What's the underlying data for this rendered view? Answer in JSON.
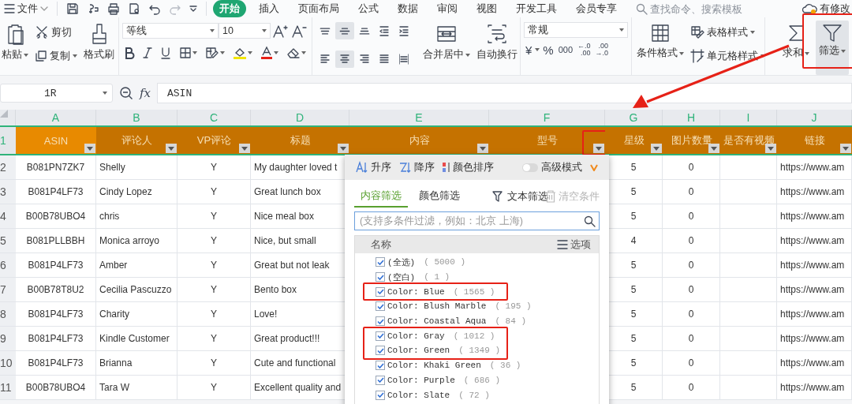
{
  "menu_bar": {
    "file_label": "文件",
    "tabs": [
      {
        "label": "开始",
        "selected": true
      },
      {
        "label": "插入",
        "selected": false
      },
      {
        "label": "页面布局",
        "selected": false
      },
      {
        "label": "公式",
        "selected": false
      },
      {
        "label": "数据",
        "selected": false
      },
      {
        "label": "审阅",
        "selected": false
      },
      {
        "label": "视图",
        "selected": false
      },
      {
        "label": "开发工具",
        "selected": false
      },
      {
        "label": "会员专享",
        "selected": false
      }
    ],
    "search": {
      "placeholder": "查找命令、搜索模板"
    },
    "status": "有修改"
  },
  "ribbon": {
    "clipboard": {
      "paste": "粘贴",
      "cut": "剪切",
      "copy": "复制",
      "format_painter": "格式刷"
    },
    "font": {
      "family": "等线",
      "size": "10"
    },
    "alignment": [
      {
        "kind": "top",
        "selected": false
      },
      {
        "kind": "middle",
        "selected": true
      },
      {
        "kind": "bottom",
        "selected": false
      },
      {
        "kind": "outdent",
        "selected": false
      },
      {
        "kind": "indent",
        "selected": false
      },
      {
        "kind": "left",
        "selected": false
      },
      {
        "kind": "center",
        "selected": true
      },
      {
        "kind": "right",
        "selected": false
      },
      {
        "kind": "justify",
        "selected": false
      },
      {
        "kind": "distribute",
        "selected": false
      }
    ],
    "merge": "合并居中",
    "wrap": "自动换行",
    "number": {
      "format": "常规",
      "currency": "¥",
      "percent": "%",
      "thousands": "000",
      "increase_decimal": [
        "←.0",
        ".00"
      ],
      "decrease_decimal": [
        ".00",
        "→.0"
      ]
    },
    "styles": {
      "conditional": "条件格式",
      "table_style": "表格样式",
      "cell_style": "单元格样式"
    },
    "sum": "求和",
    "filter": {
      "label": "筛选",
      "selected": true,
      "highlighted": true
    }
  },
  "formula_bar": {
    "name_box": "1R",
    "fx_label": "fx",
    "formula": "ASIN"
  },
  "sheet": {
    "columns": [
      "A",
      "B",
      "C",
      "D",
      "E",
      "F",
      "G",
      "H",
      "I",
      "J"
    ],
    "header_row": {
      "number": "1",
      "cells": [
        {
          "text": "ASIN",
          "selected": true,
          "highlighted": false
        },
        {
          "text": "评论人",
          "selected": false,
          "highlighted": false
        },
        {
          "text": "VP评论",
          "selected": false,
          "highlighted": false
        },
        {
          "text": "标题",
          "selected": false,
          "highlighted": false
        },
        {
          "text": "内容",
          "selected": false,
          "highlighted": false
        },
        {
          "text": "型号",
          "selected": false,
          "highlighted": true
        },
        {
          "text": "星级",
          "selected": false,
          "highlighted": false
        },
        {
          "text": "图片数量",
          "selected": false,
          "highlighted": false
        },
        {
          "text": "是否有视频",
          "selected": false,
          "highlighted": false
        },
        {
          "text": "链接",
          "selected": false,
          "highlighted": false
        }
      ]
    },
    "rows": [
      {
        "number": "2",
        "asin": "B081PN7ZK7",
        "reviewer": "Shelly",
        "vp": "Y",
        "title": "My daughter loved t",
        "rating": "5",
        "images": "0",
        "link": "https://www.am"
      },
      {
        "number": "3",
        "asin": "B081P4LF73",
        "reviewer": "Cindy Lopez",
        "vp": "Y",
        "title": "Great lunch box",
        "rating": "5",
        "images": "0",
        "link": "https://www.am"
      },
      {
        "number": "4",
        "asin": "B00B78UBO4",
        "reviewer": "chris",
        "vp": "Y",
        "title": "Nice meal box",
        "rating": "5",
        "images": "0",
        "link": "https://www.am"
      },
      {
        "number": "5",
        "asin": "B081PLLBBH",
        "reviewer": "Monica arroyo",
        "vp": "Y",
        "title": "Nice, but small",
        "rating": "4",
        "images": "0",
        "link": "https://www.am"
      },
      {
        "number": "6",
        "asin": "B081P4LF73",
        "reviewer": "Amber",
        "vp": "Y",
        "title": "Great but not leak",
        "rating": "5",
        "images": "0",
        "link": "https://www.am"
      },
      {
        "number": "7",
        "asin": "B00B78T8U2",
        "reviewer": "Cecilia Pascuzzo",
        "vp": "Y",
        "title": "Bento box",
        "rating": "5",
        "images": "0",
        "link": "https://www.am"
      },
      {
        "number": "8",
        "asin": "B081P4LF73",
        "reviewer": "Charity",
        "vp": "Y",
        "title": "Love!",
        "rating": "5",
        "images": "0",
        "link": "https://www.am"
      },
      {
        "number": "9",
        "asin": "B081P4LF73",
        "reviewer": "Kindle Customer",
        "vp": "Y",
        "title": "Great product!!!",
        "rating": "5",
        "images": "0",
        "link": "https://www.am"
      },
      {
        "number": "10",
        "asin": "B081P4LF73",
        "reviewer": "Brianna",
        "vp": "Y",
        "title": "Cute and functional",
        "rating": "5",
        "images": "0",
        "link": "https://www.am"
      },
      {
        "number": "11",
        "asin": "B00B78UBO4",
        "reviewer": "Tara W",
        "vp": "Y",
        "title": "Excellent quality and",
        "rating": "5",
        "images": "0",
        "link": "https://www.am"
      }
    ]
  },
  "filter_popup": {
    "sort_ascending": "升序",
    "sort_descending": "降序",
    "sort_by_color": "颜色排序",
    "advanced_mode": {
      "label": "高级模式",
      "on": false
    },
    "tabs": [
      {
        "label": "内容筛选",
        "selected": true
      },
      {
        "label": "颜色筛选",
        "selected": false
      }
    ],
    "text_filter": "文本筛选",
    "clear": {
      "label": "清空条件",
      "disabled": true
    },
    "search": {
      "placeholder": "(支持多条件过滤，例如：北京 上海)"
    },
    "list_header": "名称",
    "options": "选项",
    "items": [
      {
        "label": "(全选)",
        "count": "( 5000 )",
        "checked": true,
        "highlighted": false
      },
      {
        "label": "(空白)",
        "count": "( 1 )",
        "checked": true,
        "highlighted": false
      },
      {
        "label": "Color: Blue",
        "count": "( 1565 )",
        "checked": true,
        "highlighted": true
      },
      {
        "label": "Color: Blush Marble",
        "count": "( 195 )",
        "checked": true,
        "highlighted": false
      },
      {
        "label": "Color: Coastal Aqua",
        "count": "( 84 )",
        "checked": true,
        "highlighted": false
      },
      {
        "label": "Color: Gray",
        "count": "( 1012 )",
        "checked": true,
        "highlighted": true
      },
      {
        "label": "Color: Green",
        "count": "( 1349 )",
        "checked": true,
        "highlighted": true
      },
      {
        "label": "Color: Khaki Green",
        "count": "( 36 )",
        "checked": true,
        "highlighted": false
      },
      {
        "label": "Color: Purple",
        "count": "( 686 )",
        "checked": true,
        "highlighted": false
      },
      {
        "label": "Color: Slate",
        "count": "( 72 )",
        "checked": true,
        "highlighted": false
      }
    ]
  },
  "annotations": {
    "arrow": true
  }
}
